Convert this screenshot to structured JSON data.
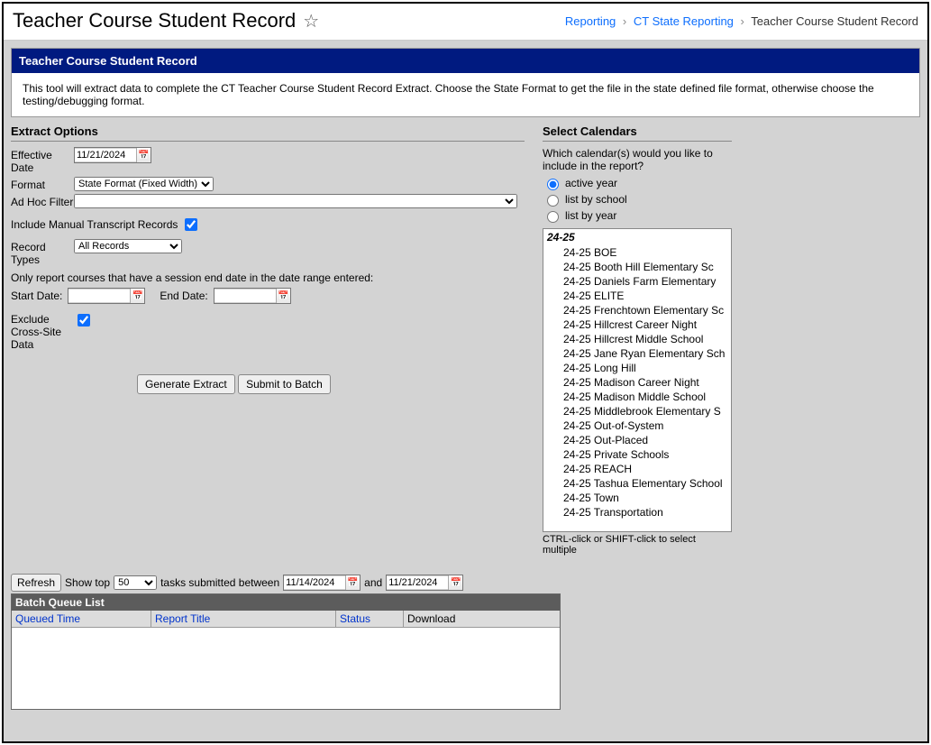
{
  "header": {
    "title": "Teacher Course Student Record",
    "breadcrumbs": {
      "item1": "Reporting",
      "item2": "CT State Reporting",
      "item3": "Teacher Course Student Record"
    }
  },
  "panel": {
    "title": "Teacher Course Student Record",
    "description": "This tool will extract data to complete the CT Teacher Course Student Record Extract. Choose the State Format to get the file in the state defined file format, otherwise choose the testing/debugging format."
  },
  "extract": {
    "section_title": "Extract Options",
    "effective_date_label": "Effective Date",
    "effective_date": "11/21/2024",
    "format_label": "Format",
    "format_value": "State Format (Fixed Width)",
    "adhoc_label": "Ad Hoc Filter",
    "include_manual_label": "Include Manual Transcript Records",
    "record_types_label": "Record Types",
    "record_types_value": "All Records",
    "date_range_note": "Only report courses that have a session end date in the date range entered:",
    "start_date_label": "Start Date:",
    "end_date_label": "End Date:",
    "exclude_label": "Exclude Cross-Site Data",
    "generate_btn": "Generate Extract",
    "submit_btn": "Submit to Batch"
  },
  "calendars": {
    "section_title": "Select Calendars",
    "prompt": "Which calendar(s) would you like to include in the report?",
    "opt_active": "active year",
    "opt_school": "list by school",
    "opt_year": "list by year",
    "year_header": "24-25",
    "items": [
      "24-25 BOE",
      "24-25 Booth Hill Elementary Sc",
      "24-25 Daniels Farm Elementary",
      "24-25 ELITE",
      "24-25 Frenchtown Elementary Sc",
      "24-25 Hillcrest Career Night",
      "24-25 Hillcrest Middle School",
      "24-25 Jane Ryan Elementary Sch",
      "24-25 Long Hill",
      "24-25 Madison Career Night",
      "24-25 Madison Middle School",
      "24-25 Middlebrook Elementary S",
      "24-25 Out-of-System",
      "24-25 Out-Placed",
      "24-25 Private Schools",
      "24-25 REACH",
      "24-25 Tashua Elementary School",
      "24-25 Town",
      "24-25 Transportation"
    ],
    "ctrl_note": "CTRL-click or SHIFT-click to select multiple"
  },
  "batch": {
    "refresh_btn": "Refresh",
    "show_top_label": "Show top",
    "show_top_value": "50",
    "tasks_between": "tasks submitted between",
    "date1": "11/14/2024",
    "and_label": "and",
    "date2": "11/21/2024",
    "list_title": "Batch Queue List",
    "col_queued": "Queued Time",
    "col_report": "Report Title",
    "col_status": "Status",
    "col_download": "Download"
  }
}
